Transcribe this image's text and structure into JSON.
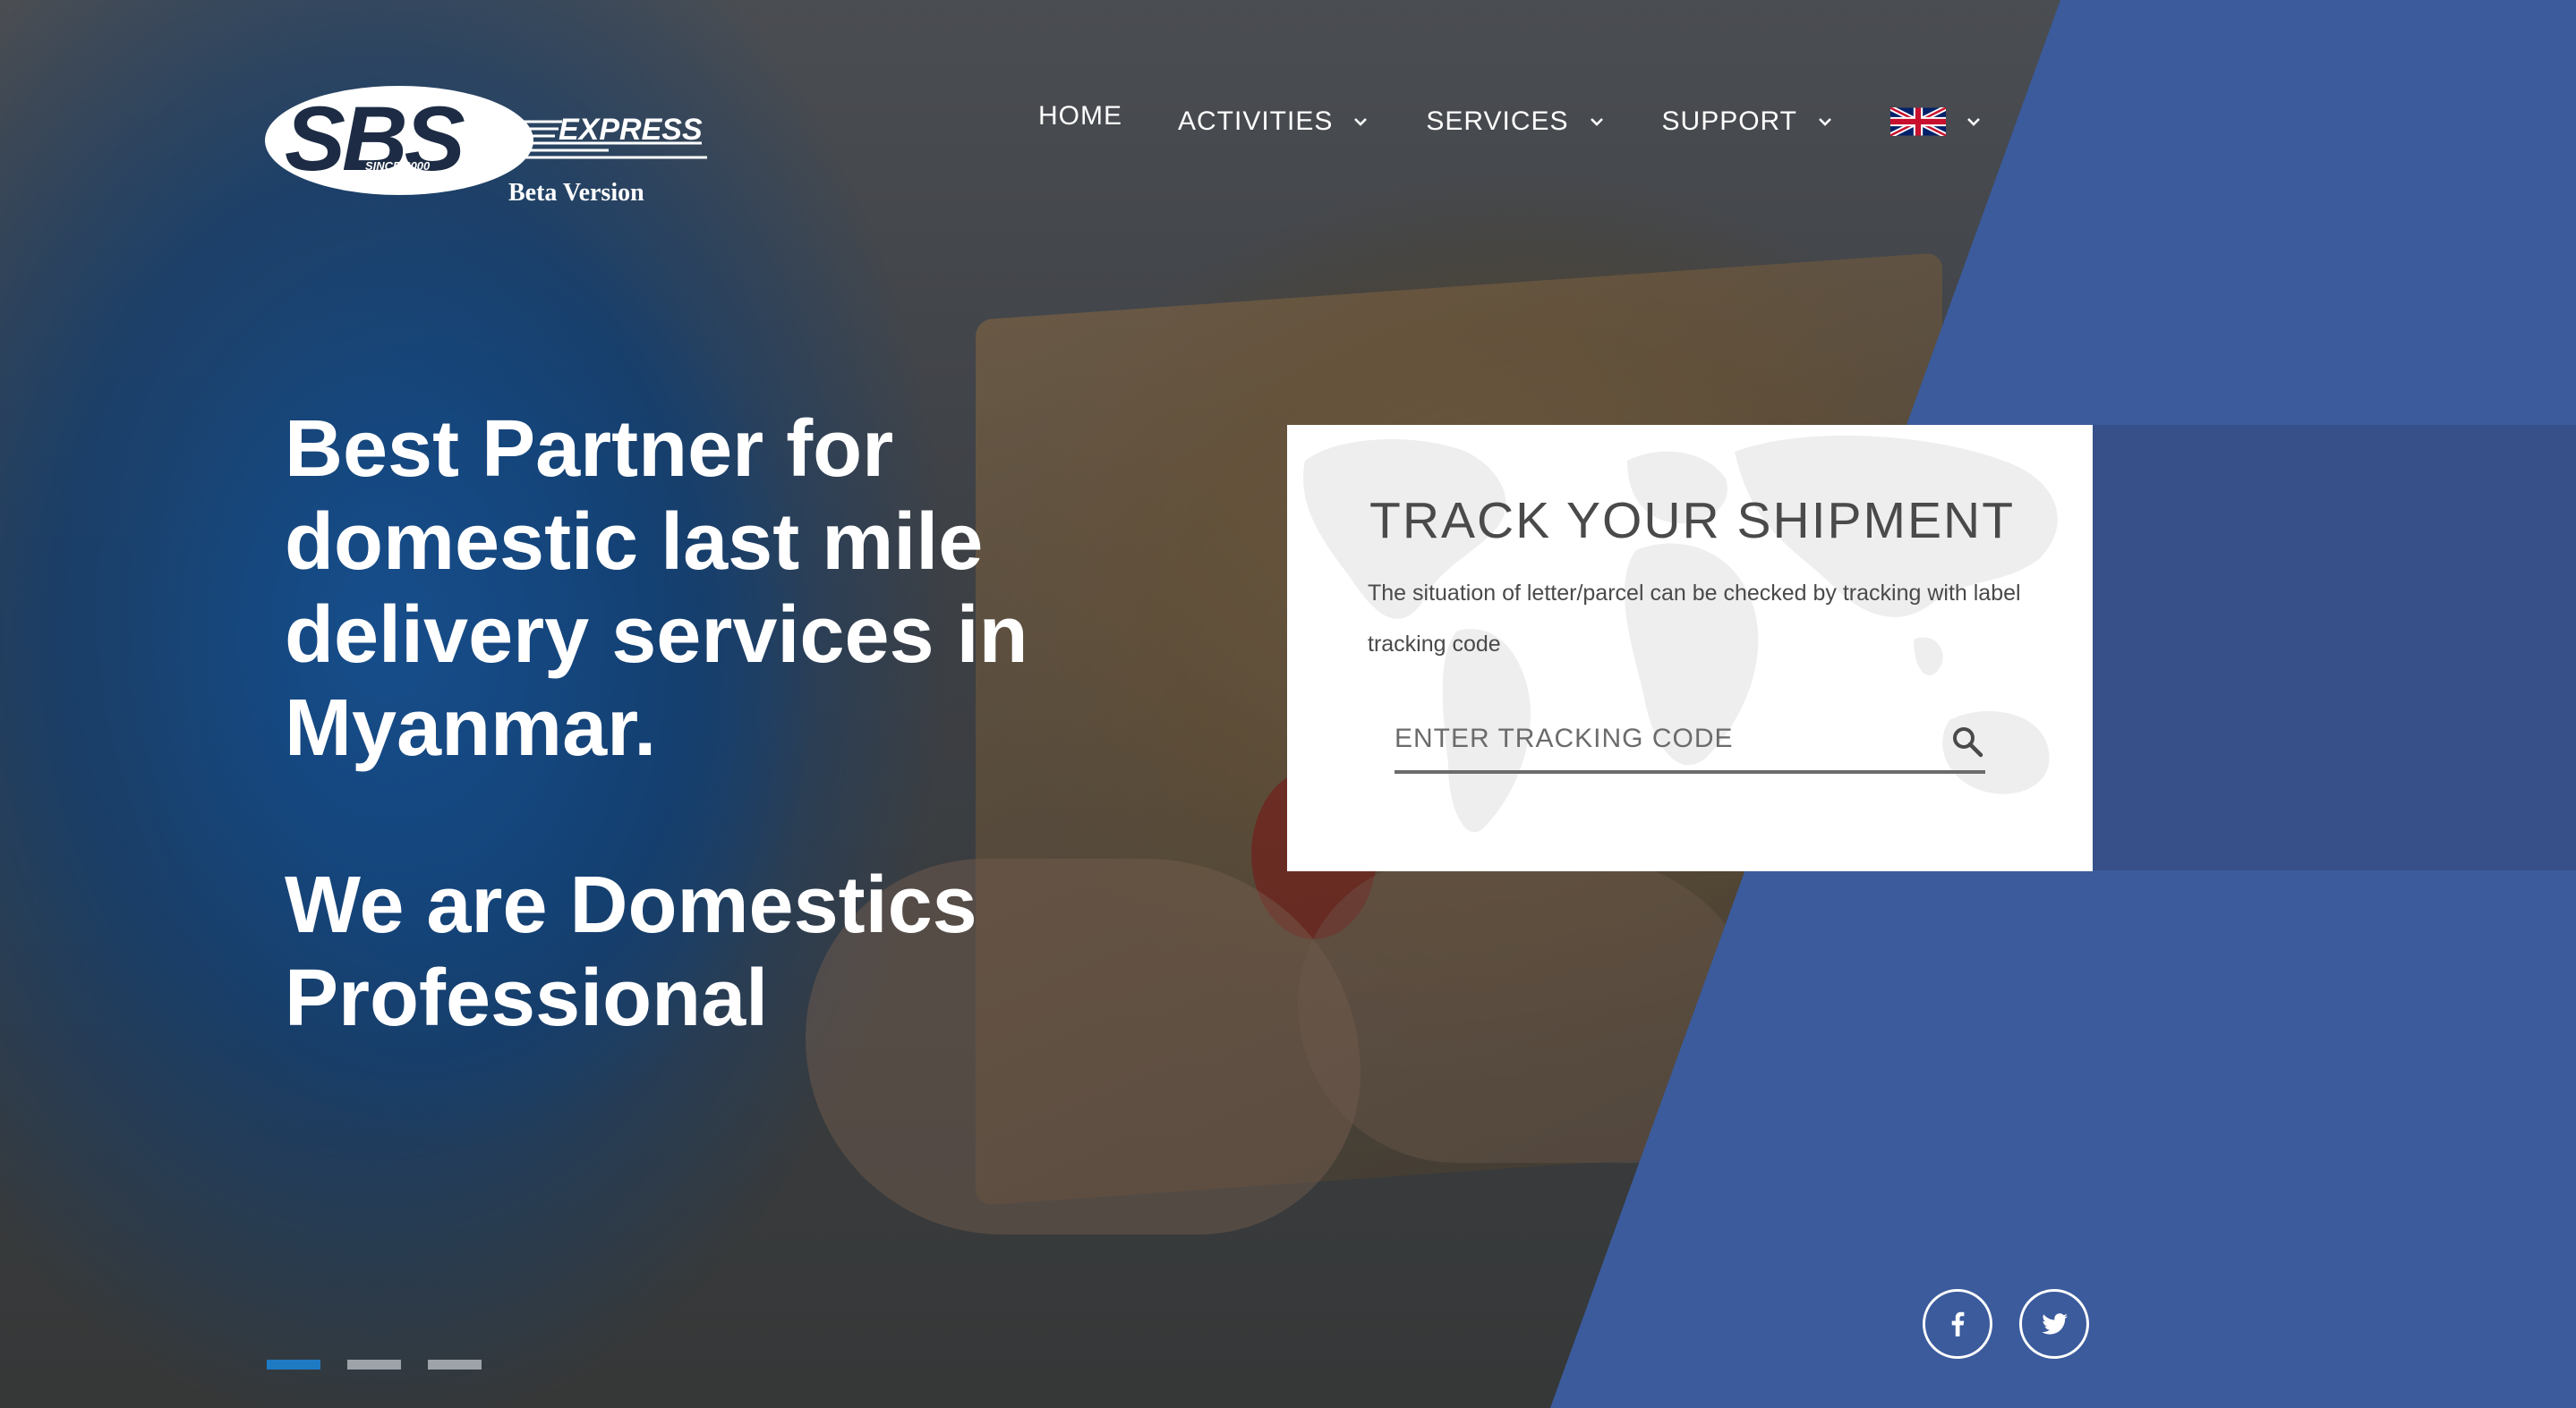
{
  "brand": {
    "logo_text": "SBS",
    "logo_express": "EXPRESS",
    "logo_since": "SINCE 2000",
    "beta_label": "Beta Version"
  },
  "nav": {
    "items": [
      {
        "label": "HOME",
        "has_dropdown": false
      },
      {
        "label": "ACTIVITIES",
        "has_dropdown": true
      },
      {
        "label": "SERVICES",
        "has_dropdown": true
      },
      {
        "label": "SUPPORT",
        "has_dropdown": true
      }
    ],
    "language_icon": "uk-flag-icon"
  },
  "hero": {
    "title": "Best Partner for domestic last mile delivery services in Myanmar.",
    "subtitle": "We are Domestics Professional"
  },
  "tracking": {
    "title": "TRACK YOUR SHIPMENT",
    "description": "The situation of letter/parcel can be checked by tracking with label tracking code",
    "input_placeholder": "ENTER TRACKING CODE",
    "input_value": "",
    "search_icon": "search-icon"
  },
  "slider": {
    "slide_count": 3,
    "active_index": 0
  },
  "social": [
    {
      "icon": "facebook-icon"
    },
    {
      "icon": "twitter-icon"
    }
  ],
  "colors": {
    "accent_blue": "#3b5b9c",
    "band_blue": "#375089",
    "active_dot": "#1f7ac4",
    "logo_navy": "#1d2c44"
  }
}
